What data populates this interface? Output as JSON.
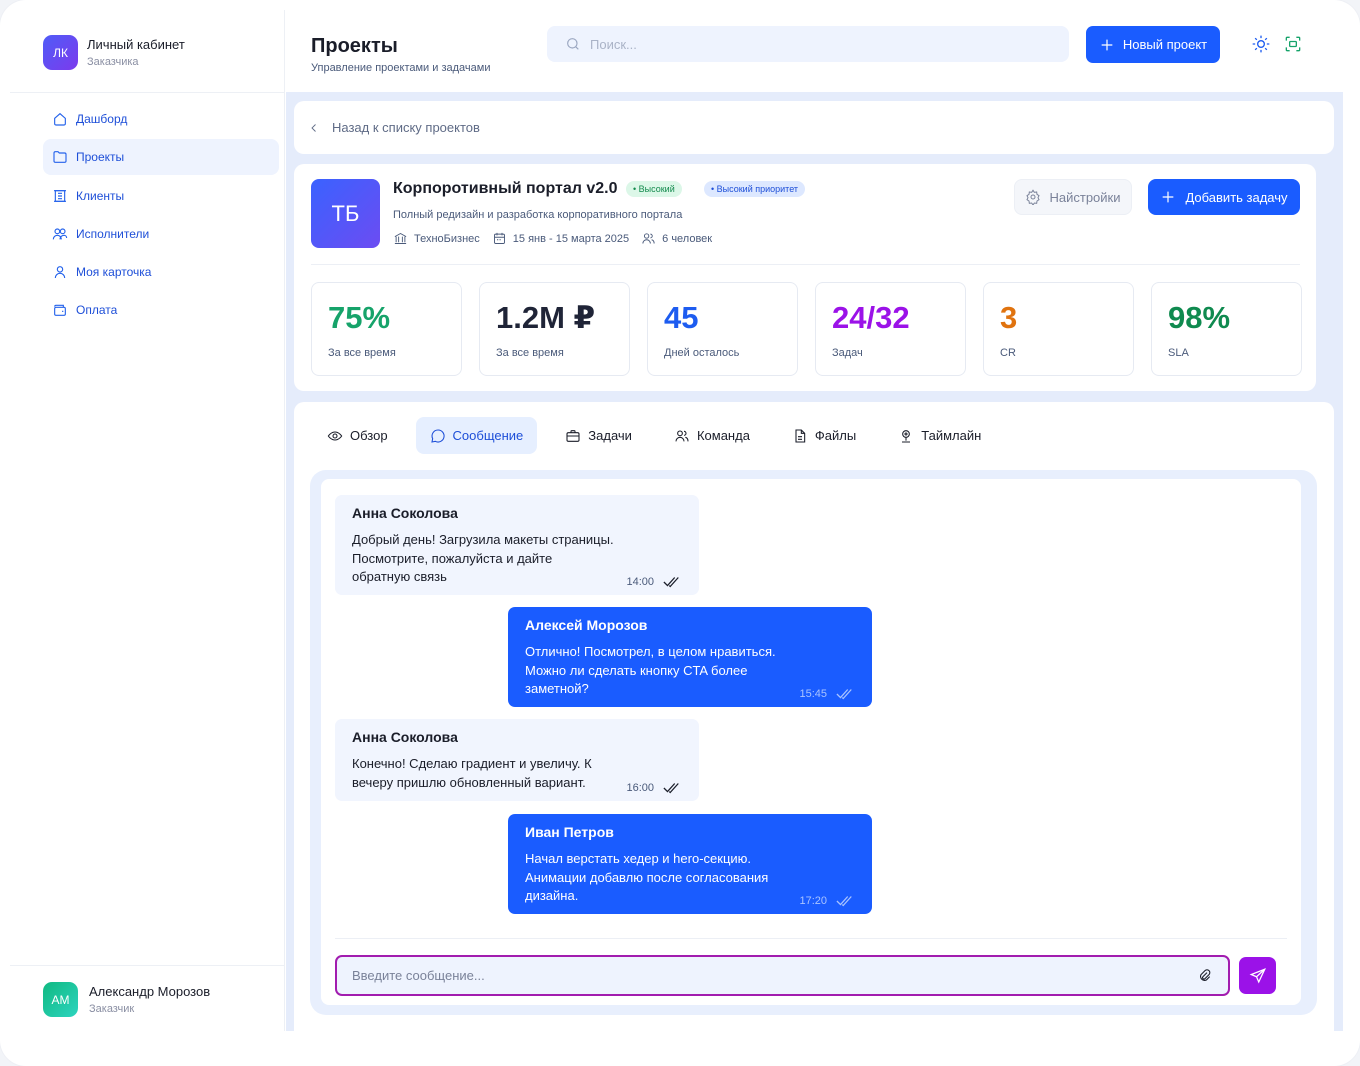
{
  "brand": {
    "initials": "ЛК",
    "title": "Личный кабинет",
    "subtitle": "Заказчика"
  },
  "sidebar": {
    "items": [
      {
        "label": "Дашборд",
        "icon": "home-icon",
        "active": false
      },
      {
        "label": "Проекты",
        "icon": "folder-icon",
        "active": true
      },
      {
        "label": "Клиенты",
        "icon": "building-icon",
        "active": false
      },
      {
        "label": "Исполнители",
        "icon": "users-icon",
        "active": false
      },
      {
        "label": "Моя карточка",
        "icon": "user-icon",
        "active": false
      },
      {
        "label": "Оплата",
        "icon": "wallet-icon",
        "active": false
      }
    ]
  },
  "user": {
    "initials": "АМ",
    "name": "Александр Морозов",
    "role": "Заказчик"
  },
  "header": {
    "title": "Проекты",
    "subtitle": "Управление проектами и задачами",
    "search_placeholder": "Поиск...",
    "new_project_label": "Новый проект"
  },
  "back": {
    "label": "Назад к списку проектов"
  },
  "project": {
    "initials": "ТБ",
    "name": "Корпоротивный портал v2.0",
    "badge_priority": "• Высокий",
    "badge_priority_high": "• Высокий приоритет",
    "description": "Полный редизайн и разработка корпоративного портала",
    "client": "ТехноБизнес",
    "dates": "15 янв - 15 марта 2025",
    "people": "6 человек",
    "settings_label": "Найстройки",
    "add_task_label": "Добавить задачу"
  },
  "stats": [
    {
      "value": "75%",
      "label": "За все время",
      "color": "#16a36a"
    },
    {
      "value": "1.2M ₽",
      "label": "За все время",
      "color": "#1f2437"
    },
    {
      "value": "45",
      "label": "Дней осталось",
      "color": "#1d5cf0"
    },
    {
      "value": "24/32",
      "label": "Задач",
      "color": "#9b12e8"
    },
    {
      "value": "3",
      "label": "CR",
      "color": "#e0730f"
    },
    {
      "value": "98%",
      "label": "SLA",
      "color": "#0f8a4f"
    }
  ],
  "tabs": [
    {
      "label": "Обзор",
      "icon": "eye-icon",
      "active": false
    },
    {
      "label": "Сообщение",
      "icon": "chat-icon",
      "active": true
    },
    {
      "label": "Задачи",
      "icon": "briefcase-icon",
      "active": false
    },
    {
      "label": "Команда",
      "icon": "team-icon",
      "active": false
    },
    {
      "label": "Файлы",
      "icon": "file-icon",
      "active": false
    },
    {
      "label": "Таймлайн",
      "icon": "pin-icon",
      "active": false
    }
  ],
  "messages": [
    {
      "author": "Анна Соколова",
      "text": "Добрый день! Загрузила макеты страницы. Посмотрите, пожалуйста и дайте обратную связь",
      "time": "14:00",
      "direction": "in"
    },
    {
      "author": "Алексей Морозов",
      "text": "Отлично! Посмотрел, в целом нравиться. Можно ли сделать кнопку CTA более заметной?",
      "time": "15:45",
      "direction": "out"
    },
    {
      "author": "Анна Соколова",
      "text": "Конечно! Сделаю градиент и увеличу. К вечеру пришлю обновленный вариант.",
      "time": "16:00",
      "direction": "in"
    },
    {
      "author": "Иван Петров",
      "text": "Начал верстать хедер и hero-секцию. Анимации добавлю после согласования дизайна.",
      "time": "17:20",
      "direction": "out"
    }
  ],
  "composer": {
    "placeholder": "Введите сообщение..."
  }
}
